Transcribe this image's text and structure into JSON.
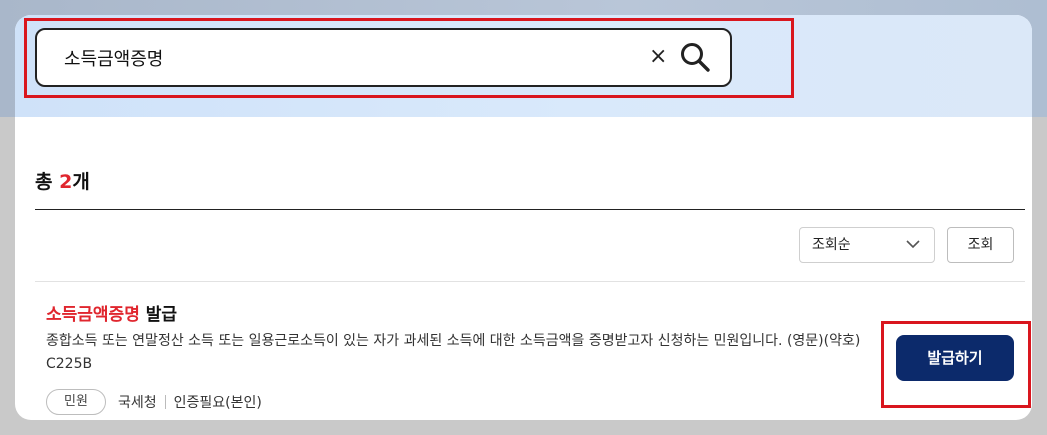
{
  "search": {
    "query": "소득금액증명",
    "clear_glyph": "×",
    "clear_icon": "close-icon",
    "search_icon": "search-icon"
  },
  "results": {
    "total_prefix": "총 ",
    "total_count": "2",
    "total_suffix": "개"
  },
  "sort": {
    "selected": "조회순",
    "view_label": "조회",
    "chevron_icon": "chevron-down-icon"
  },
  "item": {
    "title_keyword": "소득금액증명",
    "title_rest": " 발급",
    "description": "종합소득 또는 연말정산 소득 또는 일용근로소득이 있는 자가 과세된 소득에 대한 소득금액을 증명받고자 신청하는 민원입니다. (영문)(약호) C225B",
    "category_tag": "민원",
    "agency": "국세청",
    "auth_required": "인증필요(본인)",
    "action_label": "발급하기"
  },
  "colors": {
    "accent_red": "#e0262e",
    "highlight_red": "#d9161e",
    "button_navy": "#0c2a6b"
  }
}
